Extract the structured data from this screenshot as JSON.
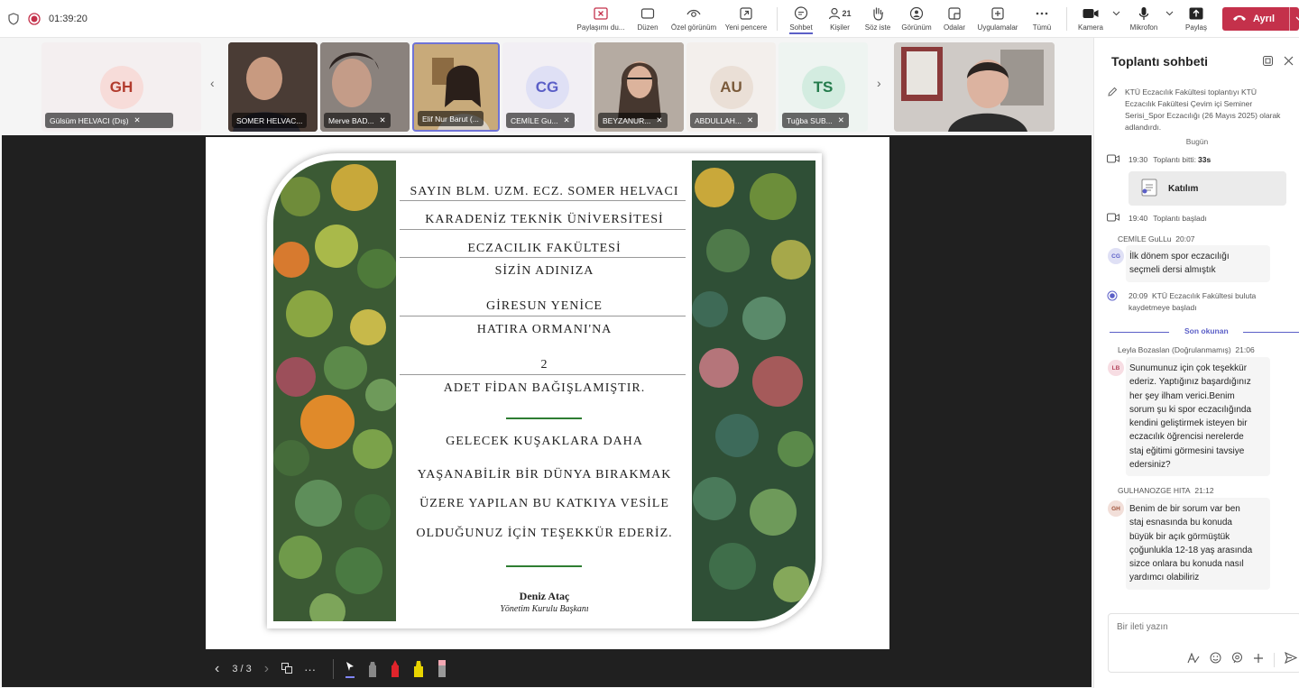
{
  "topbar": {
    "timer": "01:39:20",
    "buttons": [
      {
        "label": "Paylaşımı du...",
        "icon": "stop-sharing-icon"
      },
      {
        "label": "Düzen",
        "icon": "layout-icon"
      },
      {
        "label": "Özel görünüm",
        "icon": "eye-icon"
      },
      {
        "label": "Yeni pencere",
        "icon": "new-window-icon"
      },
      {
        "label": "Sohbet",
        "icon": "chat-icon"
      },
      {
        "label": "Kişiler",
        "icon": "people-icon",
        "count": "21"
      },
      {
        "label": "Söz iste",
        "icon": "raise-hand-icon"
      },
      {
        "label": "Görünüm",
        "icon": "view-icon"
      },
      {
        "label": "Odalar",
        "icon": "rooms-icon"
      },
      {
        "label": "Uygulamalar",
        "icon": "apps-icon"
      },
      {
        "label": "Tümü",
        "icon": "more-icon"
      },
      {
        "label": "Kamera",
        "icon": "camera-icon"
      },
      {
        "label": "Mikrofon",
        "icon": "microphone-icon"
      },
      {
        "label": "Paylaş",
        "icon": "share-icon"
      }
    ],
    "leave_label": "Ayrıl",
    "colors": {
      "leave": "#c4314b",
      "accent": "#5b5fc7",
      "rec": "#c4314b"
    }
  },
  "participants": [
    {
      "initials": "GH",
      "name": "Gülsüm HELVACI (Dış)",
      "video": false
    },
    {
      "initials": "",
      "name": "SOMER HELVAC...",
      "video": true
    },
    {
      "initials": "",
      "name": "Merve BAD...",
      "video": true
    },
    {
      "initials": "",
      "name": "Elif Nur Barut (...",
      "video": true
    },
    {
      "initials": "CG",
      "name": "CEMİLE Gu...",
      "video": false
    },
    {
      "initials": "",
      "name": "BEYZANUR...",
      "video": true
    },
    {
      "initials": "AU",
      "name": "ABDULLAH...",
      "video": false
    },
    {
      "initials": "TS",
      "name": "Tuğba SUB...",
      "video": false
    }
  ],
  "slide": {
    "lines": [
      "SAYIN BLM. UZM. ECZ. SOMER HELVACI",
      "KARADENİZ TEKNİK ÜNİVERSİTESİ",
      "ECZACILIK FAKÜLTESİ",
      "SİZİN ADINIZA",
      "GİRESUN YENİCE",
      "HATIRA ORMANI'NA",
      "2",
      "ADET FİDAN BAĞIŞLAMIŞTIR."
    ],
    "thanks": [
      "GELECEK KUŞAKLARA DAHA",
      "YAŞANABİLİR BİR DÜNYA BIRAKMAK",
      "ÜZERE YAPILAN BU KATKIYA VESİLE",
      "OLDUĞUNUZ İÇİN TEŞEKKÜR EDERİZ."
    ],
    "signer": "Deniz Ataç",
    "signer_title": "Yönetim Kurulu Başkanı",
    "page": "3 / 3"
  },
  "chat": {
    "title": "Toplantı sohbeti",
    "rename_notice": "KTÜ Eczacılık Fakültesi toplantıyı KTÜ Eczacılık Fakültesi Çevim içi Seminer Serisi_Spor Eczacılığı (26 Mayıs 2025) olarak adlandırdı.",
    "today": "Bugün",
    "ended_time": "19:30",
    "ended_text": "Toplantı bitti:",
    "ended_duration": "33s",
    "attendance_label": "Katılım",
    "started_time": "19:40",
    "started_text": "Toplantı başladı",
    "recording_time": "20:09",
    "recording_text": "KTÜ Eczacılık Fakültesi buluta kaydetmeye başladı",
    "last_read": "Son okunan",
    "messages": [
      {
        "initials": "CG",
        "sender": "CEMİLE GuLLu",
        "time": "20:07",
        "lines": [
          "İlk dönem spor eczacılığı",
          "seçmeli dersi almıştık"
        ]
      },
      {
        "initials": "LB",
        "sender": "Leyla Bozaslan (Doğrulanmamış)",
        "time": "21:06",
        "lines": [
          "Sunumunuz için çok teşekkür",
          "ederiz. Yaptığınız başardığınız",
          "her şey ilham verici.Benim",
          "sorum şu ki spor eczacılığında",
          "kendini geliştirmek isteyen bir",
          "eczacılık öğrencisi nerelerde",
          "staj eğitimi görmesini tavsiye",
          "edersiniz?"
        ]
      },
      {
        "initials": "GH",
        "sender": "GULHANOZGE HITA",
        "time": "21:12",
        "lines": [
          "Benim de bir sorum var ben",
          "staj esnasında bu konuda",
          "büyük bir açık görmüştük",
          "çoğunlukla 12-18 yaş arasında",
          "sizce onlara bu konuda nasıl",
          "yardımcı olabiliriz"
        ]
      }
    ],
    "compose_placeholder": "Bir ileti yazın"
  }
}
